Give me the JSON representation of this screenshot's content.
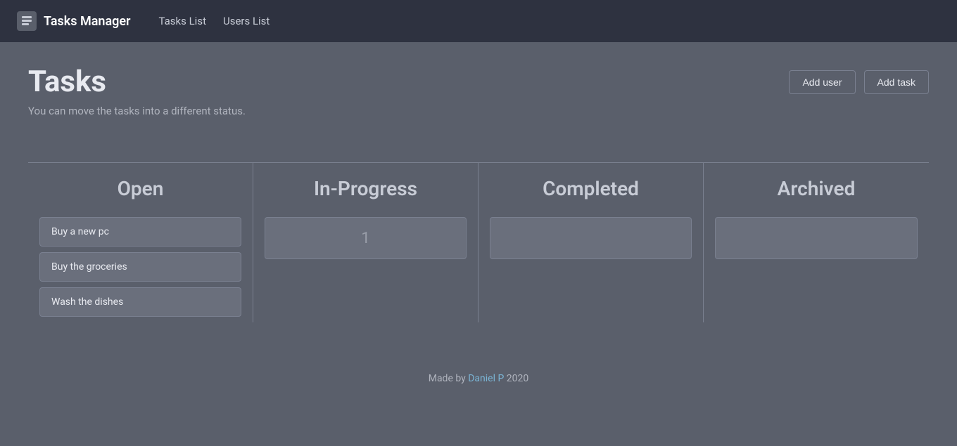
{
  "navbar": {
    "brand_icon": "list-icon",
    "brand_name": "Tasks Manager",
    "links": [
      {
        "label": "Tasks List",
        "href": "#"
      },
      {
        "label": "Users List",
        "href": "#"
      }
    ]
  },
  "page": {
    "title": "Tasks",
    "subtitle": "You can move the tasks into a different status.",
    "add_user_label": "Add user",
    "add_task_label": "Add task"
  },
  "columns": [
    {
      "id": "open",
      "header": "Open",
      "cards": [
        {
          "id": "card-1",
          "title": "Buy a new pc"
        },
        {
          "id": "card-2",
          "title": "Buy the groceries"
        },
        {
          "id": "card-3",
          "title": "Wash the dishes"
        }
      ]
    },
    {
      "id": "in-progress",
      "header": "In-Progress",
      "drop_number": "1",
      "cards": []
    },
    {
      "id": "completed",
      "header": "Completed",
      "cards": []
    },
    {
      "id": "archived",
      "header": "Archived",
      "cards": []
    }
  ],
  "footer": {
    "text_prefix": "Made by ",
    "author": "Daniel P",
    "author_href": "#",
    "text_suffix": " 2020"
  }
}
